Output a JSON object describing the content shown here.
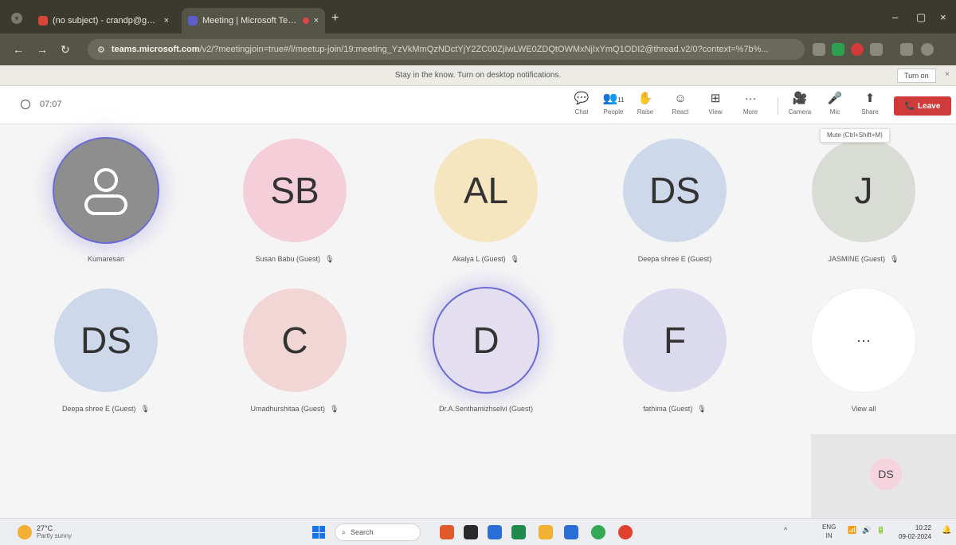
{
  "browser": {
    "tabs": [
      {
        "title": "(no subject) - crandp@gmail...",
        "close": "×",
        "favicon_color": "#d44638",
        "active": false
      },
      {
        "title": "Meeting | Microsoft Teams",
        "close": "×",
        "favicon_color": "#5b5fc7",
        "active": true
      }
    ],
    "new_tab": "+",
    "window_controls": {
      "minimize": "–",
      "maximize": "▢",
      "close": "×"
    },
    "nav": {
      "back": "←",
      "forward": "→",
      "reload": "↻"
    },
    "address": {
      "host": "teams.microsoft.com",
      "path": "/v2/?meetingjoin=true#/l/meetup-join/19:meeting_YzVkMmQzNDctYjY2ZC00ZjIwLWE0ZDQtOWMxNjIxYmQ1ODI2@thread.v2/0?context=%7b%...",
      "tune_icon": "⚙"
    },
    "extensions": [
      {
        "name": "download-icon",
        "color": "#8a8a7a"
      },
      {
        "name": "reader-icon",
        "color": "#8a8a7a"
      },
      {
        "name": "star-icon",
        "color": "#8a8a7a"
      },
      {
        "name": "extension-green-icon",
        "color": "#2e9e4f"
      },
      {
        "name": "extension-red-icon",
        "color": "#d23a3a"
      },
      {
        "name": "extensions-icon",
        "color": "#8a8a7a"
      },
      {
        "name": "sidebar-icon",
        "color": "#8a8a7a"
      },
      {
        "name": "profile-icon",
        "color": "#8a8a7a"
      }
    ]
  },
  "notification": {
    "message": "Stay in the know. Turn on desktop notifications.",
    "button": "Turn on",
    "close": "×"
  },
  "meeting": {
    "timer": "07:07",
    "controls": [
      {
        "name": "chat",
        "icon": "💬",
        "label": "Chat"
      },
      {
        "name": "people",
        "icon": "👥",
        "label": "People",
        "badge": "11"
      },
      {
        "name": "raise",
        "icon": "✋",
        "label": "Raise"
      },
      {
        "name": "react",
        "icon": "☺",
        "label": "React"
      },
      {
        "name": "view",
        "icon": "⊞",
        "label": "View"
      },
      {
        "name": "more",
        "icon": "···",
        "label": "More"
      }
    ],
    "av_controls": [
      {
        "name": "camera",
        "icon": "🎥",
        "label": "Camera"
      },
      {
        "name": "mic",
        "icon": "🎤",
        "label": "Mic"
      },
      {
        "name": "share",
        "icon": "⬆",
        "label": "Share"
      }
    ],
    "leave": {
      "icon": "📞",
      "label": "Leave"
    },
    "tooltip": "Mute (Ctrl+Shift+M)"
  },
  "participants": [
    {
      "initials": "",
      "name": "Kumaresan",
      "color": "#8e8e8e",
      "speaking": true,
      "muted": false,
      "generic": true
    },
    {
      "initials": "SB",
      "name": "Susan Babu (Guest)",
      "color": "#f4cfda",
      "speaking": false,
      "muted": true
    },
    {
      "initials": "AL",
      "name": "Akalya L (Guest)",
      "color": "#f6e6c0",
      "speaking": false,
      "muted": true
    },
    {
      "initials": "DS",
      "name": "Deepa shree E (Guest)",
      "color": "#cdd8ea",
      "speaking": false,
      "muted": false
    },
    {
      "initials": "J",
      "name": "JASMINE (Guest)",
      "color": "#d8dcd4",
      "speaking": false,
      "muted": true
    },
    {
      "initials": "DS",
      "name": "Deepa shree E (Guest)",
      "color": "#cdd8ea",
      "speaking": false,
      "muted": true
    },
    {
      "initials": "C",
      "name": "Umadhurshitaa (Guest)",
      "color": "#f2d6d6",
      "speaking": false,
      "muted": true
    },
    {
      "initials": "D",
      "name": "Dr.A.Senthamizhselvi (Guest)",
      "color": "#e4dff0",
      "speaking": true,
      "muted": false
    },
    {
      "initials": "F",
      "name": "fathima (Guest)",
      "color": "#dcdaee",
      "speaking": false,
      "muted": true
    },
    {
      "initials": "···",
      "name": "View all",
      "color": "#ffffff",
      "speaking": false,
      "muted": false
    }
  ],
  "self_view": {
    "initials": "DS"
  },
  "taskbar": {
    "weather": {
      "temp": "27°C",
      "condition": "Partly sunny"
    },
    "search": "Search",
    "apps": [
      {
        "name": "app-1-icon",
        "color": "#e05a2a"
      },
      {
        "name": "app-2-icon",
        "color": "#2a2a2a"
      },
      {
        "name": "app-3-icon",
        "color": "#2b6fd6"
      },
      {
        "name": "app-4-icon",
        "color": "#1f8a4c"
      },
      {
        "name": "app-5-icon",
        "color": "#f2b134"
      },
      {
        "name": "app-6-icon",
        "color": "#2b6fd6"
      },
      {
        "name": "app-7-icon",
        "color": "#34a853"
      },
      {
        "name": "app-8-icon",
        "color": "#e0412c"
      }
    ],
    "tray": {
      "chevron": "^",
      "lang_top": "ENG",
      "lang_bottom": "IN",
      "net": "📶",
      "vol": "🔊",
      "bat": "🔋"
    },
    "time": "10:22",
    "date": "09-02-2024"
  }
}
